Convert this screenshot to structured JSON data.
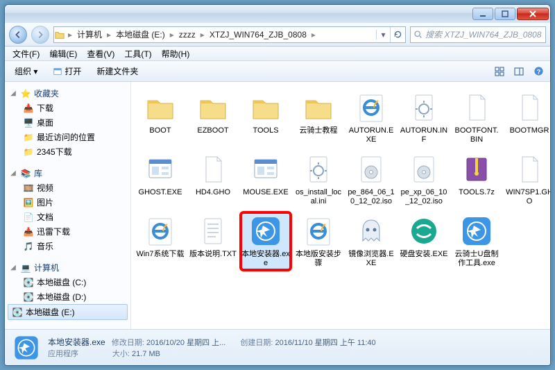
{
  "titlebar": {
    "min": "min",
    "max": "max",
    "close": "close"
  },
  "nav": {
    "breadcrumb": [
      "计算机",
      "本地磁盘 (E:)",
      "zzzz",
      "XTZJ_WIN764_ZJB_0808"
    ],
    "search_placeholder": "搜索 XTZJ_WIN764_ZJB_0808"
  },
  "menu": {
    "file": "文件(F)",
    "edit": "编辑(E)",
    "view": "查看(V)",
    "tools": "工具(T)",
    "help": "帮助(H)"
  },
  "toolbar": {
    "organize": "组织 ▾",
    "open": "打开",
    "new_folder": "新建文件夹"
  },
  "sidebar": {
    "favorites": "收藏夹",
    "fav_items": [
      "下载",
      "桌面",
      "最近访问的位置",
      "2345下载"
    ],
    "libraries": "库",
    "lib_items": [
      "视频",
      "图片",
      "文档",
      "迅雷下载",
      "音乐"
    ],
    "computer": "计算机",
    "drives": [
      "本地磁盘 (C:)",
      "本地磁盘 (D:)",
      "本地磁盘 (E:)"
    ]
  },
  "items": [
    {
      "name": "BOOT",
      "type": "folder"
    },
    {
      "name": "EZBOOT",
      "type": "folder"
    },
    {
      "name": "TOOLS",
      "type": "folder"
    },
    {
      "name": "云骑士教程",
      "type": "folder"
    },
    {
      "name": "AUTORUN.EXE",
      "type": "exe-ie"
    },
    {
      "name": "AUTORUN.INF",
      "type": "ini"
    },
    {
      "name": "BOOTFONT.BIN",
      "type": "file"
    },
    {
      "name": "BOOTMGR",
      "type": "file"
    },
    {
      "name": "GHOST.EXE",
      "type": "exe-app"
    },
    {
      "name": "HD4.GHO",
      "type": "file"
    },
    {
      "name": "MOUSE.EXE",
      "type": "exe-app"
    },
    {
      "name": "os_install_local.ini",
      "type": "ini"
    },
    {
      "name": "pe_864_06_10_12_02.iso",
      "type": "iso"
    },
    {
      "name": "pe_xp_06_10_12_02.iso",
      "type": "iso"
    },
    {
      "name": "TOOLS.7z",
      "type": "archive"
    },
    {
      "name": "WIN7SP1.GHO",
      "type": "file"
    },
    {
      "name": "Win7系统下载",
      "type": "url-ie"
    },
    {
      "name": "版本说明.TXT",
      "type": "txt"
    },
    {
      "name": "本地安装器.exe",
      "type": "exe-knight",
      "highlight": true
    },
    {
      "name": "本地版安装步骤",
      "type": "url-ie"
    },
    {
      "name": "镜像浏览器.EXE",
      "type": "exe-ghost"
    },
    {
      "name": "硬盘安装.EXE",
      "type": "exe-teal"
    },
    {
      "name": "云骑士U盘制作工具.exe",
      "type": "exe-knight"
    }
  ],
  "details": {
    "filename": "本地安装器.exe",
    "filetype": "应用程序",
    "modified_label": "修改日期:",
    "modified": "2016/10/20 星期四 上...",
    "created_label": "创建日期:",
    "created": "2016/11/10 星期四 上午 11:40",
    "size_label": "大小:",
    "size": "21.7 MB"
  }
}
